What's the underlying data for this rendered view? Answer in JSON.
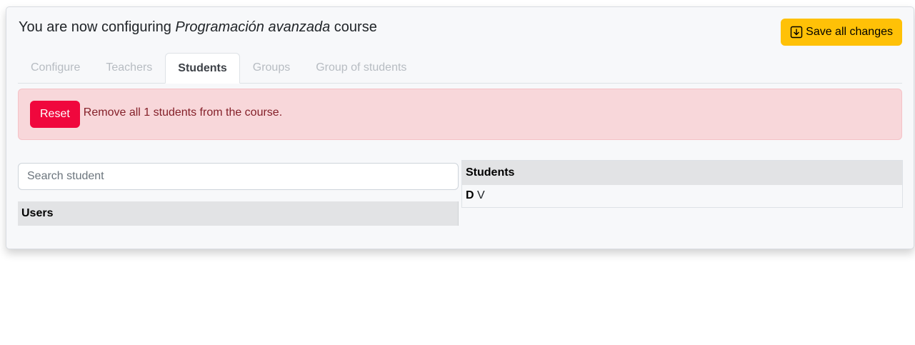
{
  "header": {
    "title_prefix": "You are now configuring",
    "course_name": "Programación avanzada",
    "title_suffix": "course",
    "save_label": "Save all changes",
    "save_icon": "download-icon"
  },
  "tabs": [
    {
      "label": "Configure",
      "active": false
    },
    {
      "label": "Teachers",
      "active": false
    },
    {
      "label": "Students",
      "active": true
    },
    {
      "label": "Groups",
      "active": false
    },
    {
      "label": "Group of students",
      "active": false
    }
  ],
  "alert": {
    "reset_label": "Reset",
    "message": "Remove all 1 students from the course."
  },
  "search": {
    "placeholder": "Search student",
    "value": ""
  },
  "users_table": {
    "header": "Users",
    "rows": []
  },
  "students_table": {
    "header": "Students",
    "rows": [
      {
        "initial": "D",
        "name": "V"
      }
    ]
  },
  "colors": {
    "accent_yellow": "#ffc107",
    "danger_red": "#f0073d",
    "alert_bg": "#f8d7da",
    "alert_text": "#842029"
  }
}
